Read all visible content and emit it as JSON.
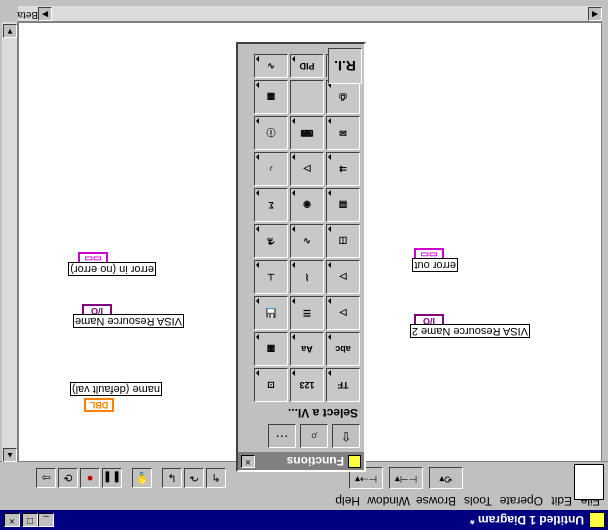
{
  "window": {
    "title": "Untitled 1 Diagram *",
    "min_glyph": "_",
    "max_glyph": "□",
    "close_glyph": "×"
  },
  "menu": [
    "File",
    "Edit",
    "Operate",
    "Tools",
    "Browse",
    "Window",
    "Help"
  ],
  "toolbar": {
    "buttons": [
      {
        "name": "run-button",
        "glyph": "⇨"
      },
      {
        "name": "run-continuous-button",
        "glyph": "⟳"
      },
      {
        "name": "abort-button",
        "glyph": "●"
      },
      {
        "name": "pause-button",
        "glyph": "❚❚"
      },
      {
        "name": "highlight-execution-button",
        "glyph": "💡"
      },
      {
        "name": "step-into-button",
        "glyph": "↳"
      },
      {
        "name": "step-over-button",
        "glyph": "↷"
      },
      {
        "name": "step-out-button",
        "glyph": "↰"
      }
    ],
    "dropdowns": [
      "⊢⇢▾",
      "⊢⊣▾",
      "⟲▾"
    ]
  },
  "status": {
    "label": "Beta"
  },
  "palette": {
    "title": "Functions",
    "select_label": "Select a VI...",
    "nav": [
      "⇧",
      "⌕",
      "⋯"
    ],
    "cells": [
      [
        "TF",
        "123",
        "⊡"
      ],
      [
        "abc",
        "Aa",
        "▦"
      ],
      [
        "▷",
        "☰",
        "💾"
      ],
      [
        "▷",
        "⌇",
        "⊥"
      ],
      [
        "◫",
        "∿",
        "⚗"
      ],
      [
        "▤",
        "◉",
        "Σ"
      ],
      [
        "⇉",
        "▷",
        "♪"
      ],
      [
        "✉",
        "⌨",
        "ⓘ"
      ],
      [
        "⎙",
        "",
        "▦"
      ],
      [
        "F",
        "PID",
        "∿"
      ],
      [
        "R.I.",
        "",
        ""
      ]
    ]
  },
  "terminals": [
    {
      "name": "name-default-val",
      "type": "DBL",
      "label": "name (default val)",
      "color": "#ff8000"
    },
    {
      "name": "visa-resource-name",
      "type": "I/O",
      "label": "VISA Resource Name",
      "color": "#800080"
    },
    {
      "name": "error-in",
      "type": "▭▭",
      "label": "error in (no error)",
      "color": "#cc00cc"
    },
    {
      "name": "visa-resource-name-2",
      "type": "I/O",
      "label": "VISA Resource Name 2",
      "color": "#800080"
    },
    {
      "name": "error-out",
      "type": "▭▭",
      "label": "error out",
      "color": "#cc00cc"
    }
  ]
}
